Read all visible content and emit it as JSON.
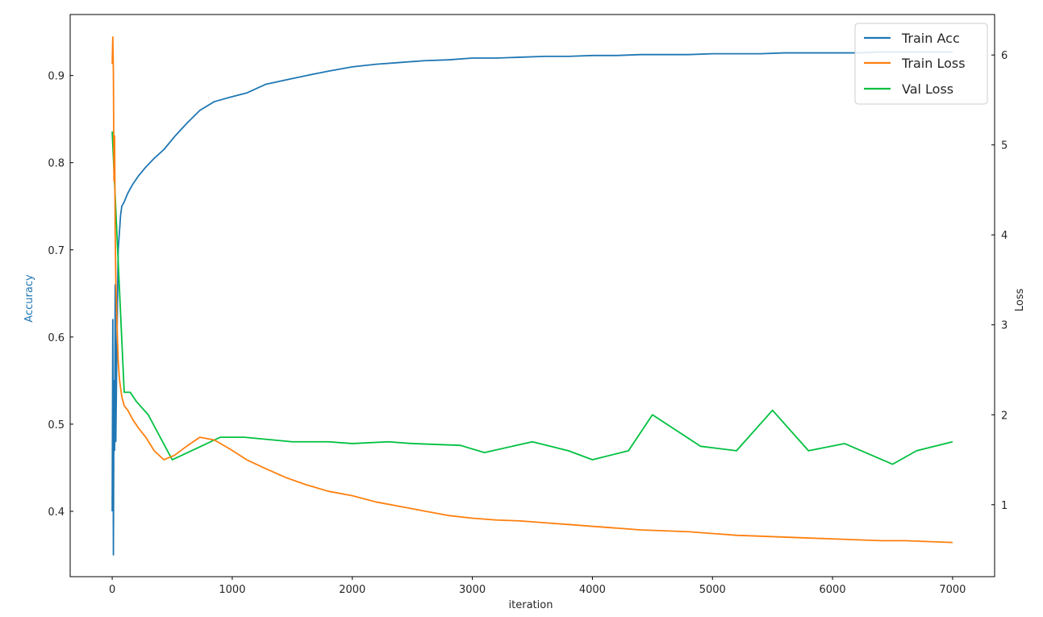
{
  "chart_data": {
    "type": "line",
    "title": "",
    "xlabel": "iteration",
    "ylabel_left": "Accuracy",
    "ylabel_right": "Loss",
    "xlim": [
      -350,
      7350
    ],
    "ylim_left": [
      0.325,
      0.97
    ],
    "ylim_right": [
      0.2,
      6.45
    ],
    "x_ticks": [
      0,
      1000,
      2000,
      3000,
      4000,
      5000,
      6000,
      7000
    ],
    "y_left_ticks": [
      0.4,
      0.5,
      0.6,
      0.7,
      0.8,
      0.9
    ],
    "y_right_ticks": [
      1,
      2,
      3,
      4,
      5,
      6
    ],
    "legend_position": "top-right",
    "grid": false,
    "colors": {
      "train_acc": "#1f77b4",
      "train_loss": "#ff7f0e",
      "val_loss": "#00c040",
      "accuracy_label": "#1f77b4"
    },
    "series": [
      {
        "name": "Train Acc",
        "axis": "left",
        "color": "#1f77b4",
        "x": [
          0,
          5,
          10,
          15,
          20,
          25,
          30,
          40,
          50,
          60,
          70,
          80,
          100,
          130,
          170,
          220,
          280,
          350,
          430,
          520,
          620,
          730,
          850,
          980,
          1120,
          1280,
          1450,
          1620,
          1800,
          2000,
          2200,
          2400,
          2600,
          2800,
          3000,
          3200,
          3400,
          3600,
          3800,
          4000,
          4200,
          4400,
          4600,
          4800,
          5000,
          5200,
          5400,
          5600,
          5800,
          6000,
          6200,
          6400,
          6600,
          6800,
          7000
        ],
        "y": [
          0.4,
          0.62,
          0.35,
          0.55,
          0.47,
          0.66,
          0.48,
          0.6,
          0.7,
          0.72,
          0.74,
          0.75,
          0.755,
          0.765,
          0.775,
          0.785,
          0.795,
          0.805,
          0.815,
          0.83,
          0.845,
          0.86,
          0.87,
          0.875,
          0.88,
          0.89,
          0.895,
          0.9,
          0.905,
          0.91,
          0.913,
          0.915,
          0.917,
          0.918,
          0.92,
          0.92,
          0.921,
          0.922,
          0.922,
          0.923,
          0.923,
          0.924,
          0.924,
          0.924,
          0.925,
          0.925,
          0.925,
          0.926,
          0.926,
          0.926,
          0.926,
          0.927,
          0.927,
          0.927,
          0.927
        ]
      },
      {
        "name": "Train Loss",
        "axis": "right",
        "color": "#ff7f0e",
        "x": [
          0,
          5,
          10,
          15,
          20,
          25,
          30,
          40,
          50,
          60,
          70,
          80,
          100,
          130,
          170,
          220,
          280,
          350,
          430,
          520,
          620,
          730,
          850,
          980,
          1120,
          1280,
          1450,
          1620,
          1800,
          2000,
          2200,
          2400,
          2600,
          2800,
          3000,
          3200,
          3400,
          3600,
          3800,
          4000,
          4200,
          4400,
          4600,
          4800,
          5000,
          5200,
          5400,
          5600,
          5800,
          6000,
          6200,
          6400,
          6600,
          6800,
          7000
        ],
        "y": [
          5.9,
          6.2,
          5.8,
          4.6,
          5.1,
          4.0,
          3.5,
          3.0,
          2.6,
          2.4,
          2.3,
          2.2,
          2.1,
          2.05,
          1.95,
          1.85,
          1.75,
          1.6,
          1.5,
          1.55,
          1.65,
          1.75,
          1.72,
          1.62,
          1.5,
          1.4,
          1.3,
          1.22,
          1.15,
          1.1,
          1.03,
          0.98,
          0.93,
          0.88,
          0.85,
          0.83,
          0.82,
          0.8,
          0.78,
          0.76,
          0.74,
          0.72,
          0.71,
          0.7,
          0.68,
          0.66,
          0.65,
          0.64,
          0.63,
          0.62,
          0.61,
          0.6,
          0.6,
          0.59,
          0.58
        ]
      },
      {
        "name": "Val Loss",
        "axis": "right",
        "color": "#00c040",
        "x": [
          0,
          100,
          150,
          200,
          300,
          500,
          900,
          1100,
          1500,
          1800,
          2000,
          2300,
          2500,
          2900,
          3100,
          3500,
          3800,
          4000,
          4300,
          4500,
          4900,
          5200,
          5500,
          5800,
          6100,
          6500,
          6700,
          7000
        ],
        "y": [
          5.15,
          2.25,
          2.25,
          2.15,
          2.0,
          1.5,
          1.75,
          1.75,
          1.7,
          1.7,
          1.68,
          1.7,
          1.68,
          1.66,
          1.58,
          1.7,
          1.6,
          1.5,
          1.6,
          2.0,
          1.65,
          1.6,
          2.05,
          1.6,
          1.68,
          1.45,
          1.6,
          1.7
        ]
      }
    ]
  }
}
